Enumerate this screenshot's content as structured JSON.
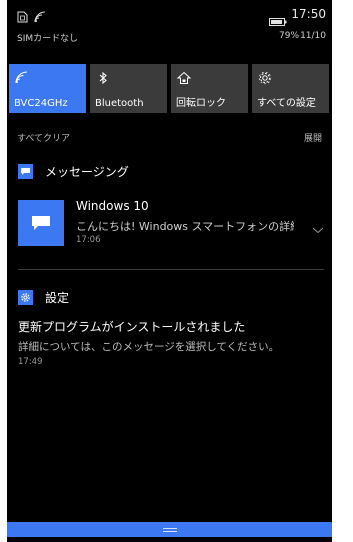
{
  "status_bar": {
    "time": "17:50",
    "carrier": "SIMカードなし",
    "battery_percent": "79%",
    "date": "11/10",
    "icons": [
      "sim-missing-icon",
      "wifi-signal-icon",
      "battery-icon"
    ]
  },
  "quick_actions": [
    {
      "label": "BVC24GHz",
      "icon": "wifi-icon",
      "active": true
    },
    {
      "label": "Bluetooth",
      "icon": "bluetooth-icon",
      "active": false
    },
    {
      "label": "回転ロック",
      "icon": "rotation-lock-icon",
      "active": false
    },
    {
      "label": "すべての設定",
      "icon": "gear-icon",
      "active": false
    }
  ],
  "actions": {
    "clear_all": "すべてクリア",
    "expand": "展開"
  },
  "messaging": {
    "group_title": "メッセージング",
    "notification": {
      "title": "Windows 10",
      "body": "こんにちは! Windows スマートフォンの詳細",
      "time": "17:06"
    }
  },
  "settings": {
    "group_title": "設定",
    "notification": {
      "title": "更新プログラムがインストールされました",
      "body": "詳細については、このメッセージを選択してください。",
      "time": "17:49"
    }
  },
  "colors": {
    "accent": "#3c78f2",
    "tile_inactive": "#3b3b3b",
    "background": "#000000"
  }
}
